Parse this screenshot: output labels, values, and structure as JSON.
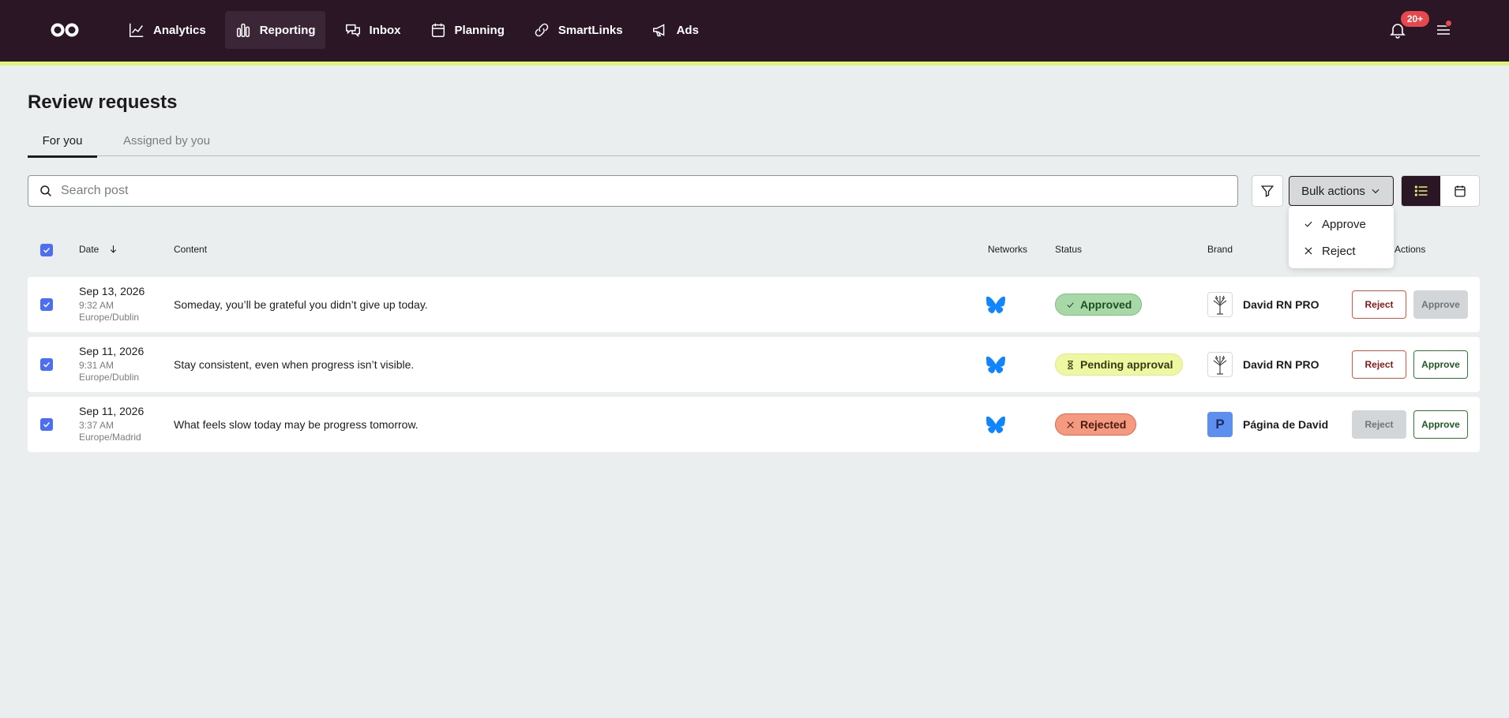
{
  "nav": {
    "items": [
      {
        "label": "Analytics",
        "icon": "chart-line-icon"
      },
      {
        "label": "Reporting",
        "icon": "bar-chart-icon"
      },
      {
        "label": "Inbox",
        "icon": "chat-bubbles-icon"
      },
      {
        "label": "Planning",
        "icon": "calendar-icon"
      },
      {
        "label": "SmartLinks",
        "icon": "link-icon"
      },
      {
        "label": "Ads",
        "icon": "megaphone-icon"
      }
    ],
    "active": "Reporting",
    "notification_count": "20+"
  },
  "page": {
    "title": "Review requests",
    "tabs": [
      {
        "label": "For you",
        "active": true
      },
      {
        "label": "Assigned by you",
        "active": false
      }
    ]
  },
  "toolbar": {
    "search_placeholder": "Search post",
    "bulk_label": "Bulk actions",
    "bulk_options": [
      "Approve",
      "Reject"
    ]
  },
  "table": {
    "headers": {
      "date": "Date",
      "content": "Content",
      "networks": "Networks",
      "status": "Status",
      "brand": "Brand",
      "actions": "Actions"
    },
    "rows": [
      {
        "date": "Sep 13, 2026",
        "time": "9:32 AM",
        "timezone": "Europe/Dublin",
        "content": "Someday, you’ll be grateful you didn’t give up today.",
        "network": "bluesky-icon",
        "status": "Approved",
        "brand": "David RN PRO",
        "reject_label": "Reject",
        "approve_label": "Approve"
      },
      {
        "date": "Sep 11, 2026",
        "time": "9:31 AM",
        "timezone": "Europe/Dublin",
        "content": "Stay consistent, even when progress isn’t visible.",
        "network": "bluesky-icon",
        "status": "Pending approval",
        "brand": "David RN PRO",
        "reject_label": "Reject",
        "approve_label": "Approve"
      },
      {
        "date": "Sep 11, 2026",
        "time": "3:37 AM",
        "timezone": "Europe/Madrid",
        "content": "What feels slow today may be progress tomorrow.",
        "network": "bluesky-icon",
        "status": "Rejected",
        "brand": "Página de David",
        "brand_initial": "P",
        "reject_label": "Reject",
        "approve_label": "Approve"
      }
    ]
  },
  "colors": {
    "topbar": "#2b1626",
    "accent": "#dff27a",
    "checkbox": "#4c6ef5",
    "bluesky": "#1185fe"
  }
}
